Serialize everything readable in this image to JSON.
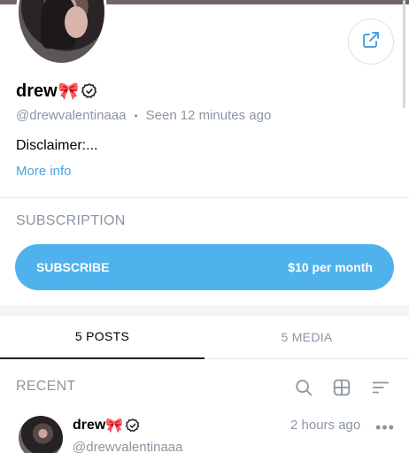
{
  "profile": {
    "name": "drew",
    "emoji": "🎀",
    "handle": "@drewvalentinaaa",
    "seen_label": "Seen",
    "seen_time": "12 minutes ago",
    "disclaimer": "Disclaimer:...",
    "more_info": "More info"
  },
  "subscription": {
    "heading": "SUBSCRIPTION",
    "button_label": "SUBSCRIBE",
    "price": "$10 per month"
  },
  "tabs": [
    {
      "label": "5 POSTS",
      "active": true
    },
    {
      "label": "5 MEDIA",
      "active": false
    }
  ],
  "feed": {
    "heading": "RECENT"
  },
  "post": {
    "name": "drew",
    "emoji": "🎀",
    "time": "2 hours ago",
    "handle": "@drewvalentinaaa",
    "more": "•••"
  },
  "colors": {
    "accent": "#4fb2ec",
    "link": "#4aa3e0",
    "muted": "#8a96a3"
  },
  "icons": [
    "share-icon",
    "verified-icon",
    "search-icon",
    "grid-icon",
    "sort-icon",
    "more-icon"
  ]
}
